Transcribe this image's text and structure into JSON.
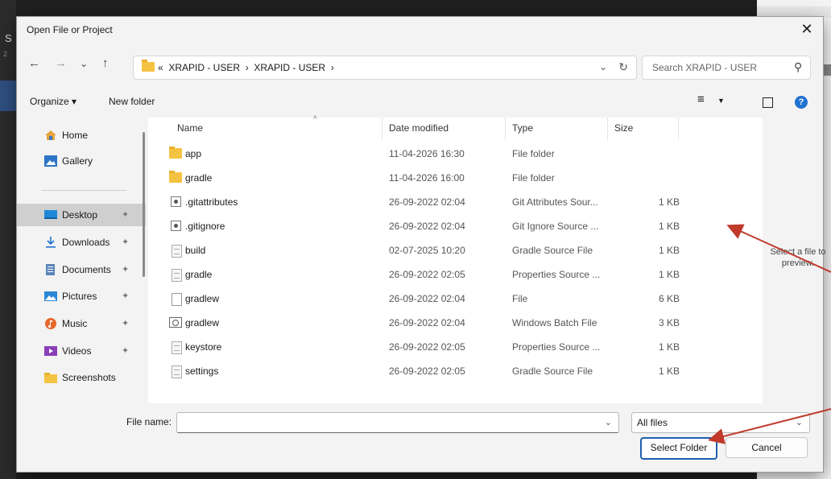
{
  "background": {
    "left_letter": "S",
    "left_number": "2"
  },
  "dialog": {
    "title": "Open File or Project",
    "close": "✕"
  },
  "navbar": {
    "back": "←",
    "forward": "→",
    "recent": "⌄",
    "up": "↑",
    "breadcrumb": "«  XRAPID - USER  ›  XRAPID - USER  ›",
    "dropdown": "⌄",
    "refresh": "↻",
    "search_placeholder": "Search XRAPID - USER",
    "search_icon": "⚲"
  },
  "toolbar": {
    "organize": "Organize ▾",
    "new_folder": "New folder",
    "view_icon": "≡",
    "view_dropdown": "▼",
    "help": "?"
  },
  "sidebar": {
    "items": [
      {
        "label": "Home",
        "icon": "home-icon",
        "pinned": false
      },
      {
        "label": "Gallery",
        "icon": "gallery-icon",
        "pinned": false
      },
      {
        "label": "Desktop",
        "icon": "desktop-icon",
        "pinned": true,
        "selected": true
      },
      {
        "label": "Downloads",
        "icon": "downloads-icon",
        "pinned": true
      },
      {
        "label": "Documents",
        "icon": "documents-icon",
        "pinned": true
      },
      {
        "label": "Pictures",
        "icon": "pictures-icon",
        "pinned": true
      },
      {
        "label": "Music",
        "icon": "music-icon",
        "pinned": true
      },
      {
        "label": "Videos",
        "icon": "videos-icon",
        "pinned": true
      },
      {
        "label": "Screenshots",
        "icon": "folder-icon",
        "pinned": false
      }
    ],
    "pin_glyph": "✦"
  },
  "files": {
    "columns": {
      "name": "Name",
      "date": "Date modified",
      "type": "Type",
      "size": "Size"
    },
    "sort_arrow": "^",
    "rows": [
      {
        "name": "app",
        "date": "11-04-2026 16:30",
        "type": "File folder",
        "size": "",
        "icon": "folder"
      },
      {
        "name": "gradle",
        "date": "11-04-2026 16:00",
        "type": "File folder",
        "size": "",
        "icon": "folder"
      },
      {
        "name": ".gitattributes",
        "date": "26-09-2022 02:04",
        "type": "Git Attributes Sour...",
        "size": "1 KB",
        "icon": "gear"
      },
      {
        "name": ".gitignore",
        "date": "26-09-2022 02:04",
        "type": "Git Ignore Source ...",
        "size": "1 KB",
        "icon": "gear"
      },
      {
        "name": "build",
        "date": "02-07-2025 10:20",
        "type": "Gradle Source File",
        "size": "1 KB",
        "icon": "text"
      },
      {
        "name": "gradle",
        "date": "26-09-2022 02:05",
        "type": "Properties Source ...",
        "size": "1 KB",
        "icon": "text"
      },
      {
        "name": "gradlew",
        "date": "26-09-2022 02:04",
        "type": "File",
        "size": "6 KB",
        "icon": "file"
      },
      {
        "name": "gradlew",
        "date": "26-09-2022 02:04",
        "type": "Windows Batch File",
        "size": "3 KB",
        "icon": "batch"
      },
      {
        "name": "keystore",
        "date": "26-09-2022 02:05",
        "type": "Properties Source ...",
        "size": "1 KB",
        "icon": "text"
      },
      {
        "name": "settings",
        "date": "26-09-2022 02:05",
        "type": "Gradle Source File",
        "size": "1 KB",
        "icon": "text"
      }
    ]
  },
  "preview": {
    "text": "Select a file to preview."
  },
  "bottom": {
    "file_name_label": "File name:",
    "file_name_value": "",
    "file_name_dropdown": "⌄",
    "filter_value": "All files",
    "filter_dropdown": "⌄",
    "select_folder": "Select Folder",
    "cancel": "Cancel"
  },
  "annotation_color": "#c0392b",
  "accent_color": "#1f5fb0"
}
